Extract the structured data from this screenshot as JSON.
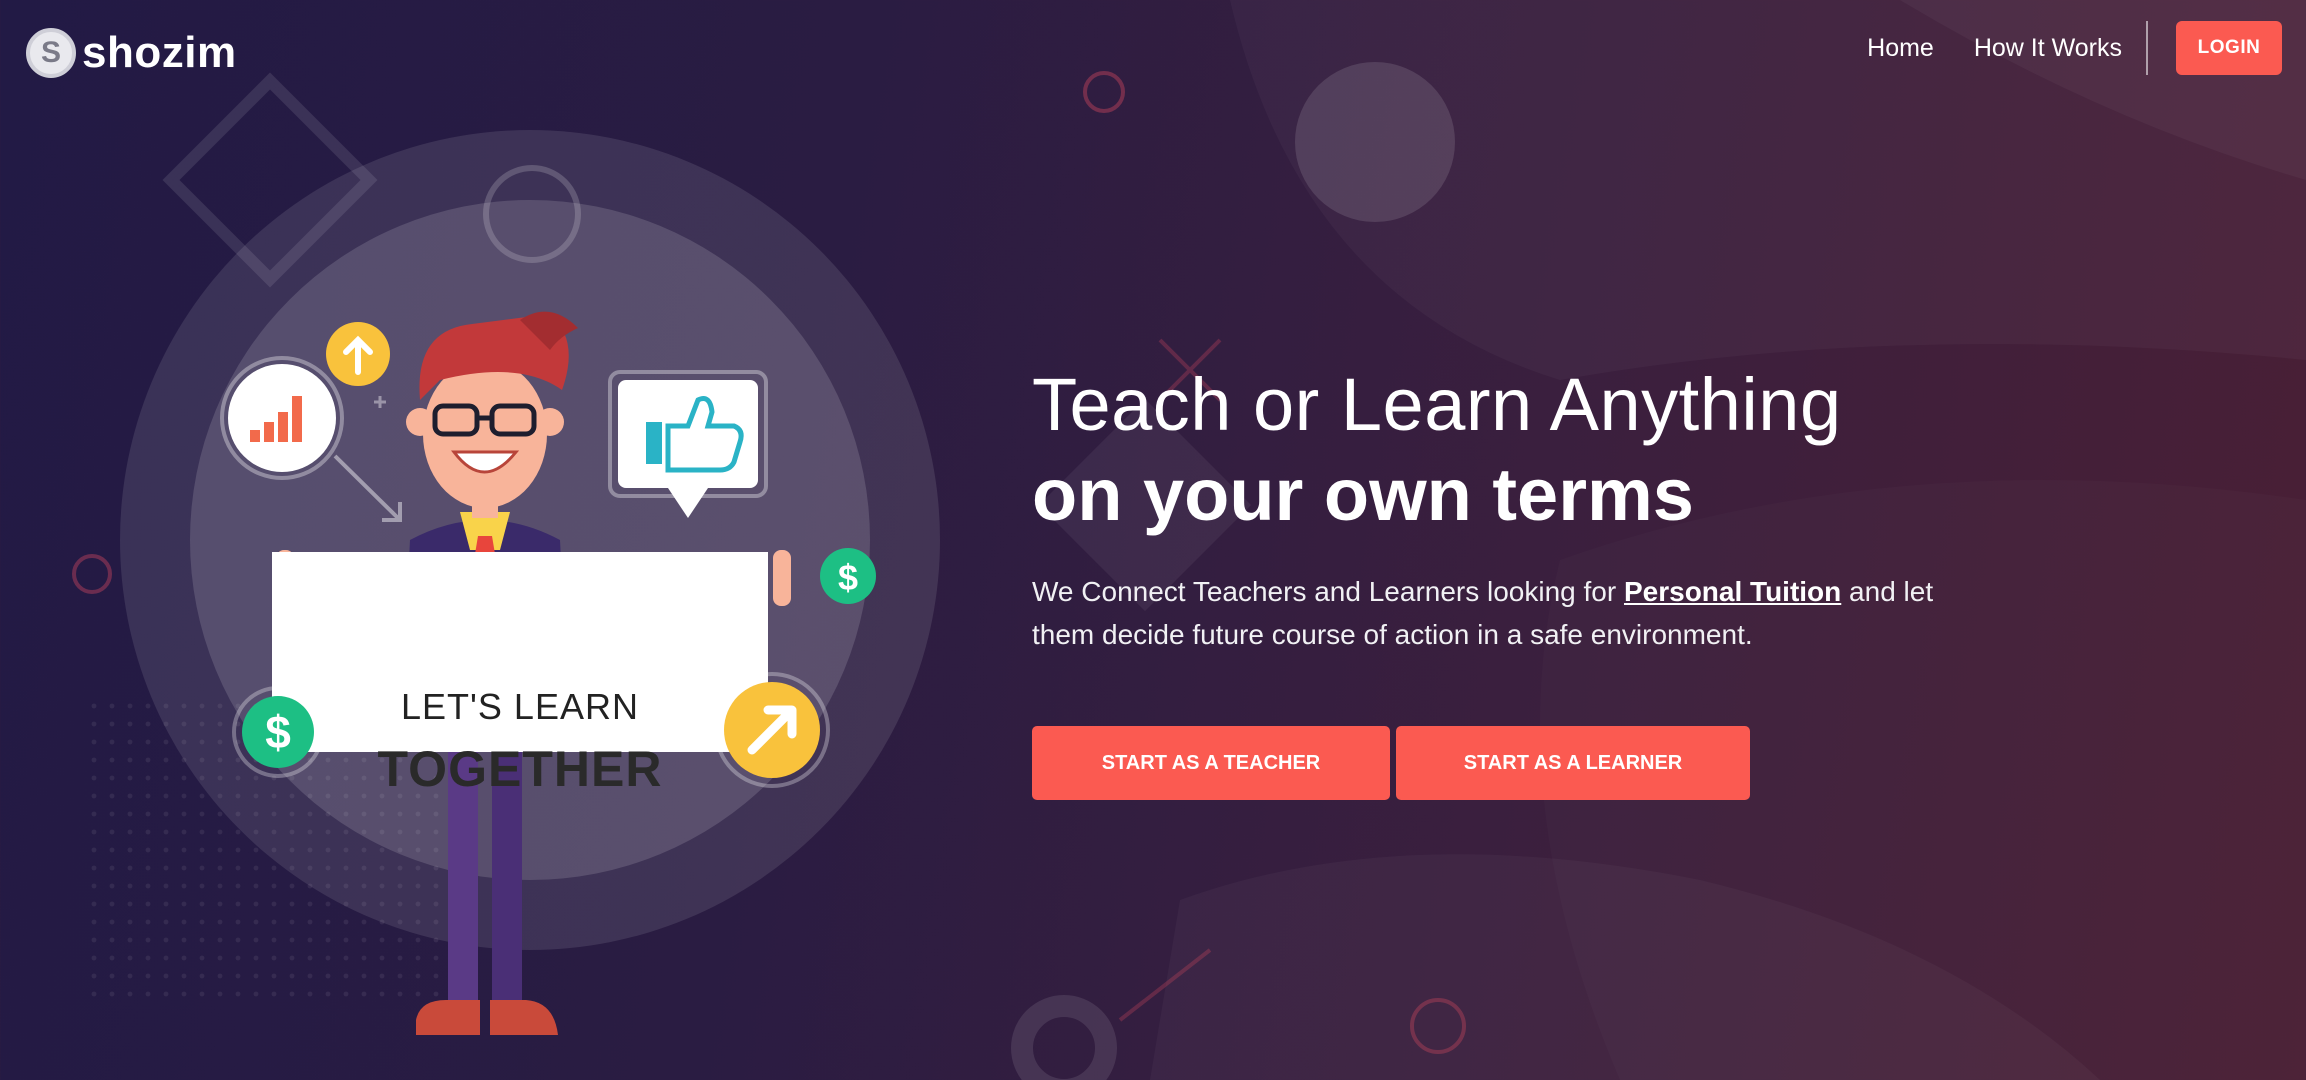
{
  "brand": {
    "logo_letter": "S",
    "name": "shozim"
  },
  "nav": {
    "links": [
      "Home",
      "How It Works"
    ],
    "login_label": "LOGIN"
  },
  "hero": {
    "title_line1": "Teach or Learn Anything",
    "title_line2": "on your own terms",
    "desc_before": "We Connect Teachers and Learners looking for ",
    "desc_highlight": "Personal Tuition",
    "desc_after": " and let them decide future course of action in a safe environment.",
    "cta_teacher": "START AS A TEACHER",
    "cta_learner": "START AS A LEARNER"
  },
  "illustration": {
    "sign_line1": "LET'S LEARN",
    "sign_line2": "TOGETHER",
    "dollar_symbol": "$"
  },
  "colors": {
    "accent": "#fb5a51",
    "bg_left": "#221a45",
    "bg_right": "#4a1f35"
  }
}
